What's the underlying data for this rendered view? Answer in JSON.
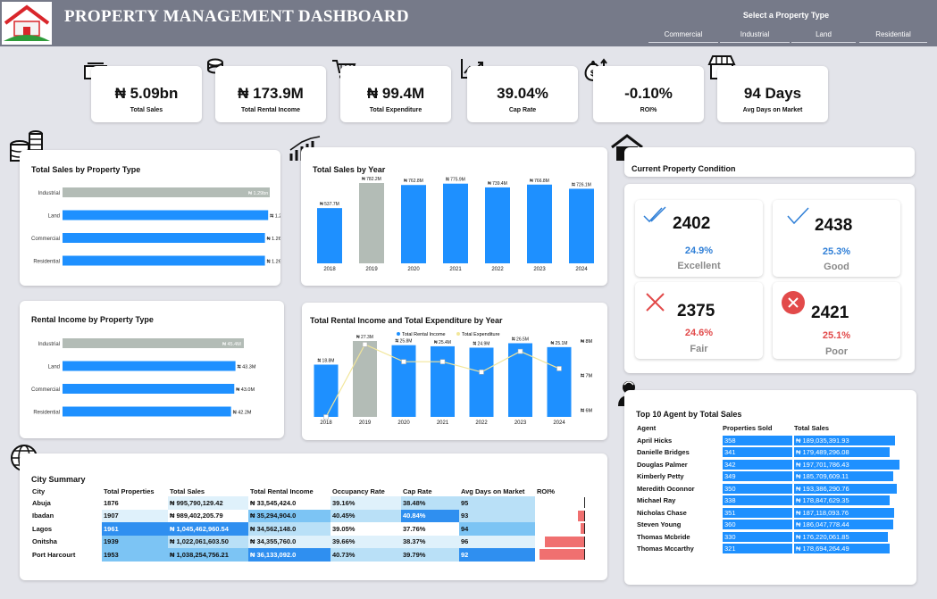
{
  "header": {
    "title": "PROPERTY MANAGEMENT DASHBOARD",
    "slicer_title": "Select a Property Type",
    "slicer_options": [
      "Commercial",
      "Industrial",
      "Land",
      "Residential"
    ]
  },
  "kpis": [
    {
      "value": "₦ 5.09bn",
      "label": "Total Sales",
      "icon": "money-icon"
    },
    {
      "value": "₦ 173.9M",
      "label": "Total Rental Income",
      "icon": "coins-icon"
    },
    {
      "value": "₦ 99.4M",
      "label": "Total Expenditure",
      "icon": "cart-icon"
    },
    {
      "value": "39.04%",
      "label": "Cap Rate",
      "icon": "trend-up-icon"
    },
    {
      "value": "-0.10%",
      "label": "ROI%",
      "icon": "money-bag-icon"
    },
    {
      "value": "94 Days",
      "label": "Avg Days on Market",
      "icon": "shop-icon"
    }
  ],
  "colors": {
    "blue": "#1e90ff",
    "grey": "#b3bcb6",
    "header": "#767a89",
    "red": "#f07070",
    "line": "#f2e69a"
  },
  "chart_data": [
    {
      "type": "bar",
      "title": "Total Sales by Property Type",
      "orientation": "horizontal",
      "categories": [
        "Industrial",
        "Land",
        "Commercial",
        "Residential"
      ],
      "values": [
        1.29,
        1.28,
        1.26,
        1.26
      ],
      "labels": [
        "₦ 1.29bn",
        "₦ 1.28bn",
        "₦ 1.26bn",
        "₦ 1.26bn"
      ]
    },
    {
      "type": "bar",
      "title": "Total Sales by Year",
      "categories": [
        "2018",
        "2019",
        "2020",
        "2021",
        "2022",
        "2023",
        "2024"
      ],
      "values": [
        537.7,
        782.2,
        762.8,
        775.9,
        739.4,
        766.8,
        726.1
      ],
      "labels": [
        "₦ 537.7M",
        "₦ 782.2M",
        "₦ 762.8M",
        "₦ 775.9M",
        "₦ 739.4M",
        "₦ 766.8M",
        "₦ 726.1M"
      ]
    },
    {
      "type": "bar",
      "title": "Rental Income by Property Type",
      "orientation": "horizontal",
      "categories": [
        "Industrial",
        "Land",
        "Commercial",
        "Residential"
      ],
      "values": [
        45.4,
        43.3,
        43.0,
        42.2
      ],
      "labels": [
        "₦ 45.4M",
        "₦ 43.3M",
        "₦ 43.0M",
        "₦ 42.2M"
      ]
    },
    {
      "type": "bar",
      "title": "Total Rental Income and Total Expenditure by Year",
      "categories": [
        "2018",
        "2019",
        "2020",
        "2021",
        "2022",
        "2023",
        "2024"
      ],
      "series": [
        {
          "name": "Total Rental Income",
          "values": [
            18.8,
            27.3,
            25.8,
            25.4,
            24.9,
            26.5,
            25.1
          ],
          "labels": [
            "₦ 18.8M",
            "₦ 27.3M",
            "₦ 25.8M",
            "₦ 25.4M",
            "₦ 24.9M",
            "₦ 26.5M",
            "₦ 25.1M"
          ]
        },
        {
          "name": "Total Expenditure",
          "values": [
            5.8,
            7.9,
            7.4,
            7.4,
            7.1,
            7.7,
            7.2
          ]
        }
      ],
      "y2_ticks": [
        "₦ 8M",
        "₦ 7M",
        "₦ 6M"
      ],
      "y2lim": [
        5.8,
        8.0
      ]
    }
  ],
  "condition": {
    "title": "Current Property Condition",
    "items": [
      {
        "count": "2402",
        "pct": "24.9%",
        "label": "Excellent",
        "icon": "double-check-icon"
      },
      {
        "count": "2438",
        "pct": "25.3%",
        "label": "Good",
        "icon": "check-icon"
      },
      {
        "count": "2375",
        "pct": "24.6%",
        "label": "Fair",
        "icon": "cross-icon"
      },
      {
        "count": "2421",
        "pct": "25.1%",
        "label": "Poor",
        "icon": "x-circle-icon"
      }
    ]
  },
  "city": {
    "title": "City Summary",
    "headers": [
      "City",
      "Total Properties",
      "Total Sales",
      "Total Rental Income",
      "Occupancy Rate",
      "Cap Rate",
      "Avg Days on Market",
      "ROI%"
    ],
    "rows": [
      {
        "city": "Abuja",
        "props": "1876",
        "sales": "₦ 995,790,129.42",
        "rental": "₦ 33,545,424.0",
        "occ": "39.16%",
        "cap": "38.48%",
        "days": "95",
        "roi": 0.0
      },
      {
        "city": "Ibadan",
        "props": "1907",
        "sales": "₦ 989,402,205.79",
        "rental": "₦ 35,294,904.0",
        "occ": "40.45%",
        "cap": "40.84%",
        "days": "93",
        "roi": -0.12
      },
      {
        "city": "Lagos",
        "props": "1961",
        "sales": "₦ 1,045,462,960.54",
        "rental": "₦ 34,562,148.0",
        "occ": "39.05%",
        "cap": "37.76%",
        "days": "94",
        "roi": -0.07
      },
      {
        "city": "Onitsha",
        "props": "1939",
        "sales": "₦ 1,022,061,603.50",
        "rental": "₦ 34,355,760.0",
        "occ": "39.66%",
        "cap": "38.37%",
        "days": "96",
        "roi": -0.78
      },
      {
        "city": "Port Harcourt",
        "props": "1953",
        "sales": "₦ 1,038,254,756.21",
        "rental": "₦ 36,133,092.0",
        "occ": "40.73%",
        "cap": "39.79%",
        "days": "92",
        "roi": -0.88
      }
    ]
  },
  "agents": {
    "title": "Top 10 Agent by Total Sales",
    "headers": [
      "Agent",
      "Properties Sold",
      "Total Sales"
    ],
    "rows": [
      {
        "name": "April Hicks",
        "sold": "358",
        "sales": "₦ 189,035,391.93",
        "v": 189.0
      },
      {
        "name": "Danielle Bridges",
        "sold": "341",
        "sales": "₦ 179,489,296.08",
        "v": 179.5
      },
      {
        "name": "Douglas Palmer",
        "sold": "342",
        "sales": "₦ 197,701,786.43",
        "v": 197.7
      },
      {
        "name": "Kimberly Petty",
        "sold": "349",
        "sales": "₦ 185,709,609.11",
        "v": 185.7
      },
      {
        "name": "Meredith Oconnor",
        "sold": "350",
        "sales": "₦ 193,386,290.76",
        "v": 193.4
      },
      {
        "name": "Michael Ray",
        "sold": "338",
        "sales": "₦ 178,847,629.35",
        "v": 178.8
      },
      {
        "name": "Nicholas Chase",
        "sold": "351",
        "sales": "₦ 187,118,093.76",
        "v": 187.1
      },
      {
        "name": "Steven Young",
        "sold": "360",
        "sales": "₦ 186,047,778.44",
        "v": 186.0
      },
      {
        "name": "Thomas Mcbride",
        "sold": "330",
        "sales": "₦ 176,220,061.85",
        "v": 176.2
      },
      {
        "name": "Thomas Mccarthy",
        "sold": "321",
        "sales": "₦ 178,694,264.49",
        "v": 178.7
      }
    ]
  }
}
